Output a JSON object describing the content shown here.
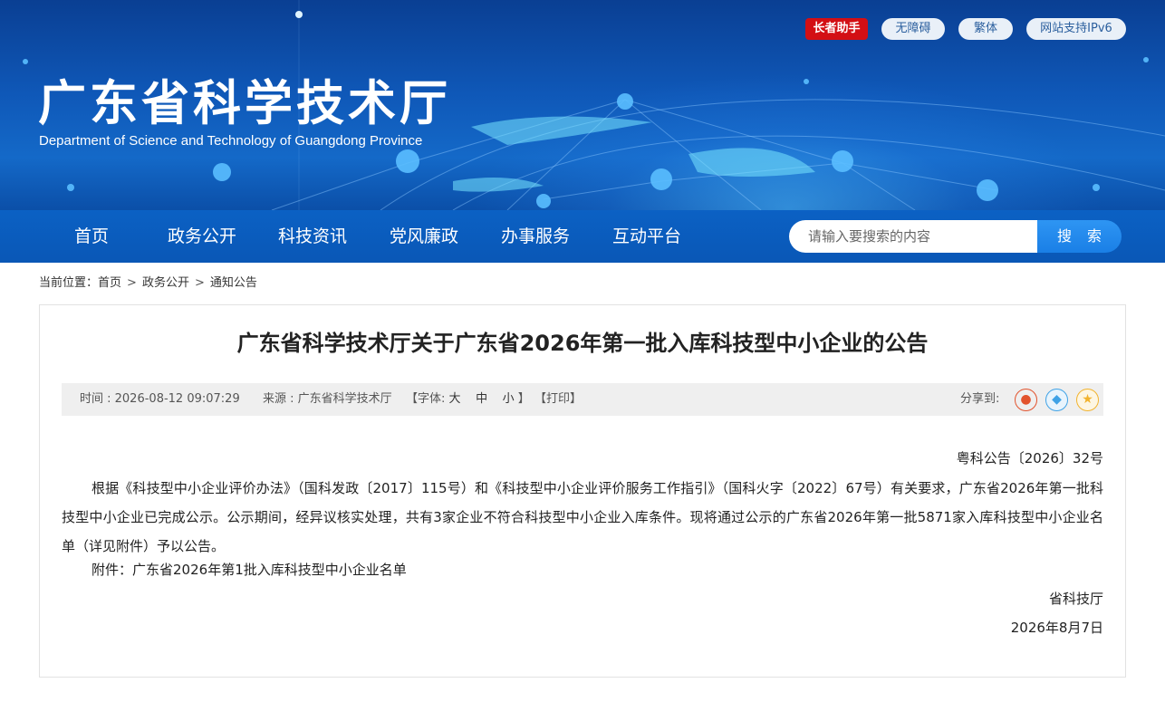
{
  "header": {
    "title": "广东省科学技术厅",
    "subtitle": "Department of Science and Technology of Guangdong Province",
    "tools": {
      "elder": "长者助手",
      "accessible": "无障碍",
      "traditional": "繁体",
      "ipv6": "网站支持IPv6"
    }
  },
  "nav": {
    "items": [
      "首页",
      "政务公开",
      "科技资讯",
      "党风廉政",
      "办事服务",
      "互动平台"
    ],
    "search_placeholder": "请输入要搜索的内容",
    "search_button": "搜 索"
  },
  "breadcrumb": {
    "prefix": "当前位置：",
    "items": [
      "首页",
      "政务公开",
      "通知公告"
    ],
    "separator": ">"
  },
  "article": {
    "title": "广东省科学技术厅关于广东省2026年第一批入库科技型中小企业的公告",
    "meta": {
      "time": "时间 : 2026-08-12 09:07:29",
      "source": "来源 : 广东省科学技术厅",
      "font_prefix": "【字体:",
      "font_large": "大",
      "font_medium": "中",
      "font_small": "小",
      "font_suffix": "】",
      "print": "【打印】",
      "share_label": "分享到:"
    },
    "doc_number": "粤科公告〔2026〕32号",
    "body": "根据《科技型中小企业评价办法》（国科发政〔2017〕115号）和《科技型中小企业评价服务工作指引》（国科火字〔2022〕67号）有关要求，广东省2026年第一批科技型中小企业已完成公示。公示期间，经异议核实处理，共有3家企业不符合科技型中小企业入库条件。现将通过公示的广东省2026年第一批5871家入库科技型中小企业名单（详见附件）予以公告。",
    "attachment_label": "附件：",
    "attachment_link": "广东省2026年第1批入库科技型中小企业名单",
    "sign_org": "省科技厅",
    "sign_date": "2026年8月7日"
  },
  "colors": {
    "banner": "#0f58b8",
    "nav": "#0a57b6",
    "search_button": "#1a7fe6",
    "elder_badge": "#d30f14"
  }
}
